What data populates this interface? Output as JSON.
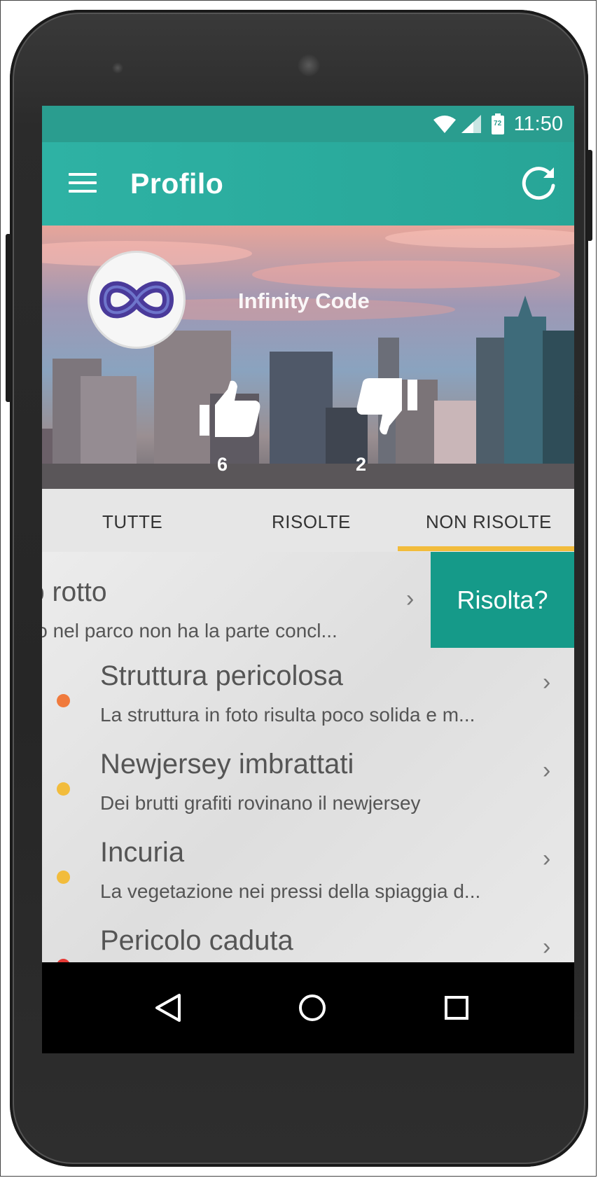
{
  "status_bar": {
    "time": "11:50",
    "battery": "72"
  },
  "app_bar": {
    "title": "Profilo"
  },
  "profile": {
    "name": "Infinity Code",
    "likes": "6",
    "dislikes": "2"
  },
  "tabs": [
    {
      "label": "TUTTE"
    },
    {
      "label": "RISOLTE"
    },
    {
      "label": "NON RISOLTE",
      "selected": true
    }
  ],
  "swiped_item": {
    "title": "o rotto",
    "subtitle": "lo nel parco non ha la parte concl...",
    "action_label": "Risolta?"
  },
  "items": [
    {
      "title": "Struttura pericolosa",
      "subtitle": "La struttura in foto risulta poco solida e m...",
      "dot_color": "#f07a3c"
    },
    {
      "title": "Newjersey imbrattati",
      "subtitle": "Dei brutti grafiti rovinano il newjersey",
      "dot_color": "#f2bc3c"
    },
    {
      "title": "Incuria",
      "subtitle": "La vegetazione nei pressi della spiaggia d...",
      "dot_color": "#f2bc3c"
    },
    {
      "title": "Pericolo caduta",
      "subtitle": "",
      "dot_color": "#e53935"
    }
  ],
  "colors": {
    "status_bar": "#2a9d8f",
    "app_bar": "#2eb2a4",
    "tab_indicator": "#f2bc3c",
    "action_button": "#159a89"
  },
  "icons": [
    "wifi-icon",
    "signal-icon",
    "battery-icon",
    "menu-icon",
    "refresh-icon",
    "thumbs-up-icon",
    "thumbs-down-icon",
    "chevron-right-icon",
    "nav-back-icon",
    "nav-home-icon",
    "nav-recent-icon"
  ]
}
